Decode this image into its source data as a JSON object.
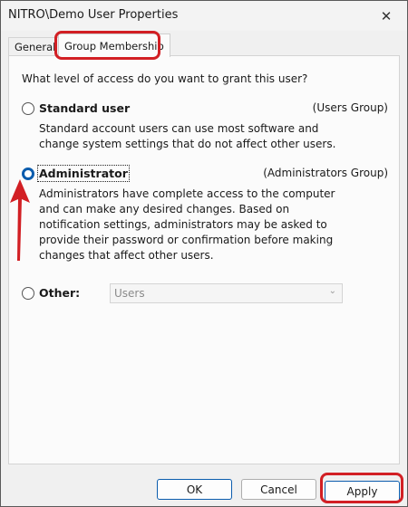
{
  "window": {
    "title": "NITRO\\Demo User Properties",
    "close_glyph": "✕"
  },
  "tabs": [
    {
      "label": "General",
      "active": false
    },
    {
      "label": "Group Membership",
      "active": true
    }
  ],
  "panel": {
    "question": "What level of access do you want to grant this user?",
    "options": [
      {
        "label": "Standard user",
        "group": "(Users Group)",
        "checked": false,
        "description": [
          "Standard account users can use most software and",
          "change system settings that do not affect other users."
        ]
      },
      {
        "label": "Administrator",
        "group": "(Administrators Group)",
        "checked": true,
        "description": [
          "Administrators have complete access to the computer",
          "and can make any desired changes. Based on",
          "notification settings, administrators may be asked to",
          "provide their password or confirmation before making",
          "changes that affect other users."
        ]
      },
      {
        "label": "Other:",
        "checked": false,
        "select_value": "Users"
      }
    ]
  },
  "buttons": {
    "ok": "OK",
    "cancel": "Cancel",
    "apply": "Apply"
  },
  "colors": {
    "annotation": "#d21f24",
    "radio_checked": "#0b5cad"
  }
}
